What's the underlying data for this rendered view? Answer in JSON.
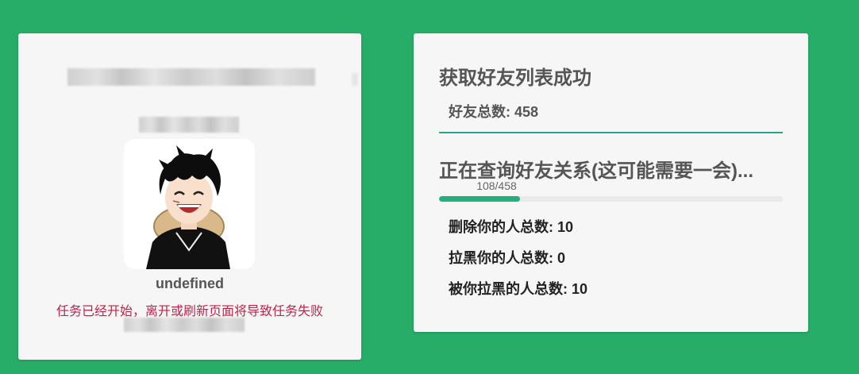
{
  "profile": {
    "username": "undefined",
    "warning": "任务已经开始，离开或刷新页面将导致任务失败",
    "avatar_icon": "cartoon-avatar-icon"
  },
  "status": {
    "success_heading": "获取好友列表成功",
    "friend_total": "好友总数: 458",
    "querying_heading": "正在查询好友关系(这可能需要一会)...",
    "progress_text": "108/458",
    "progress_current": 108,
    "progress_total": 458,
    "stats": {
      "deleted_you": "删除你的人总数: 10",
      "blocked_you": "拉黑你的人总数: 0",
      "blocked_by_you": "被你拉黑的人总数: 10"
    }
  },
  "colors": {
    "background": "#27ad68",
    "card": "#f6f6f6",
    "warning": "#c0234a",
    "progress_fill": "#22b07a",
    "divider": "#22aa88"
  }
}
